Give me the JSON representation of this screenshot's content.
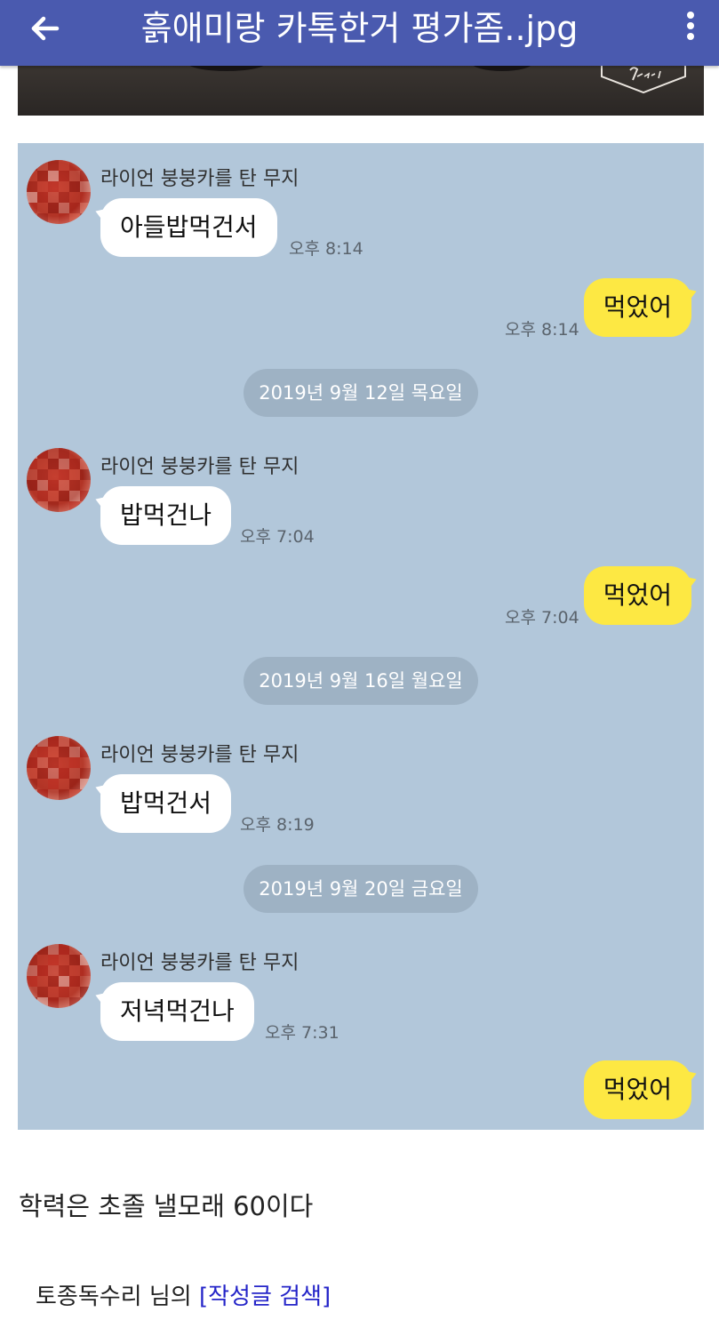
{
  "appbar": {
    "title": "흙애미랑 카톡한거 평가좀..jpg",
    "back_icon": "arrow-left-icon",
    "menu_icon": "more-vertical-icon",
    "color": "#4a5aaf"
  },
  "chat": {
    "background_color": "#b2c7da",
    "incoming_bubble_color": "#ffffff",
    "outgoing_bubble_color": "#fde843",
    "messages": [
      {
        "sender": "라이언 붕붕카를 탄 무지",
        "text": "아들밥먹건서",
        "time": "오후 8:14"
      },
      {
        "text": "먹었어",
        "time": "오후 8:14"
      },
      {
        "date": "2019년 9월 12일 목요일"
      },
      {
        "sender": "라이언 붕붕카를 탄 무지",
        "text": "밥먹건나",
        "time": "오후 7:04"
      },
      {
        "text": "먹었어",
        "time": "오후 7:04"
      },
      {
        "date": "2019년 9월 16일 월요일"
      },
      {
        "sender": "라이언 붕붕카를 탄 무지",
        "text": "밥먹건서",
        "time": "오후 8:19"
      },
      {
        "date": "2019년 9월 20일 금요일"
      },
      {
        "sender": "라이언 붕붕카를 탄 무지",
        "text": "저녁먹건나",
        "time": "오후 7:31"
      },
      {
        "text": "먹었어"
      }
    ]
  },
  "post": {
    "caption": "학력은 초졸 낼모래 60이다",
    "author_prefix": "토종독수리 님의 ",
    "search_link": "[작성글 검색]",
    "link_color": "#2424c8"
  }
}
